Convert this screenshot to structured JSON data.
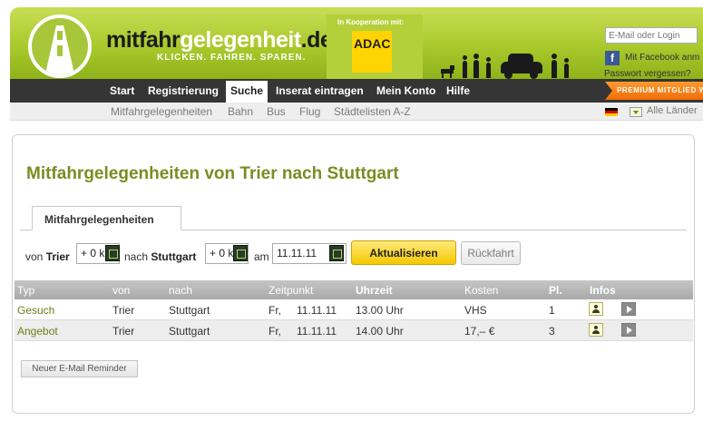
{
  "header": {
    "brand_part1": "mitfahr",
    "brand_part2": "gelegenheit",
    "brand_part3": ".de",
    "tagline": "KLICKEN. FAHREN. SPAREN.",
    "cooperation_label": "In Kooperation mit:",
    "partner": "ADAC",
    "login_placeholder": "E-Mail oder Login",
    "facebook_label": "Mit Facebook anm",
    "password_forgot": "Passwort vergessen?"
  },
  "nav": {
    "items": [
      "Start",
      "Registrierung",
      "Suche",
      "Inserat eintragen",
      "Mein Konto",
      "Hilfe"
    ],
    "active": "Suche",
    "premium_label": "PREMIUM MITGLIED W"
  },
  "subnav": {
    "items": [
      "Mitfahrgelegenheiten",
      "Bahn",
      "Bus",
      "Flug",
      "Städtelisten A-Z"
    ],
    "countries": "Alle Länder"
  },
  "page": {
    "title": "Mitfahrgelegenheiten von Trier nach Stuttgart",
    "tab": "Mitfahrgelegenheiten"
  },
  "filter": {
    "from_prefix": "von",
    "from_city": "Trier",
    "from_radius": "+ 0 k",
    "to_prefix": "nach",
    "to_city": "Stuttgart",
    "to_radius": "+ 0 k",
    "date_prefix": "am",
    "date": "11.11.11",
    "update_button": "Aktualisieren",
    "return_button": "Rückfahrt"
  },
  "table": {
    "headers": [
      "Typ",
      "von",
      "nach",
      "Zeitpunkt",
      "Uhrzeit",
      "Kosten",
      "Pl.",
      "Infos"
    ],
    "rows": [
      {
        "typ": "Gesuch",
        "von": "Trier",
        "nach": "Stuttgart",
        "tag": "Fr,",
        "datum": "11.11.11",
        "uhrzeit": "13.00 Uhr",
        "kosten": "VHS",
        "plaetze": "1"
      },
      {
        "typ": "Angebot",
        "von": "Trier",
        "nach": "Stuttgart",
        "tag": "Fr,",
        "datum": "11.11.11",
        "uhrzeit": "14.00 Uhr",
        "kosten": "17,– €",
        "plaetze": "3"
      }
    ]
  },
  "reminder_button": "Neuer E-Mail Reminder",
  "colors": {
    "brand_green": "#a9c92c",
    "title_olive": "#7d8b22",
    "nav_dark": "#353535",
    "button_yellow": "#f5c800",
    "premium_orange": "#ef6d08"
  }
}
